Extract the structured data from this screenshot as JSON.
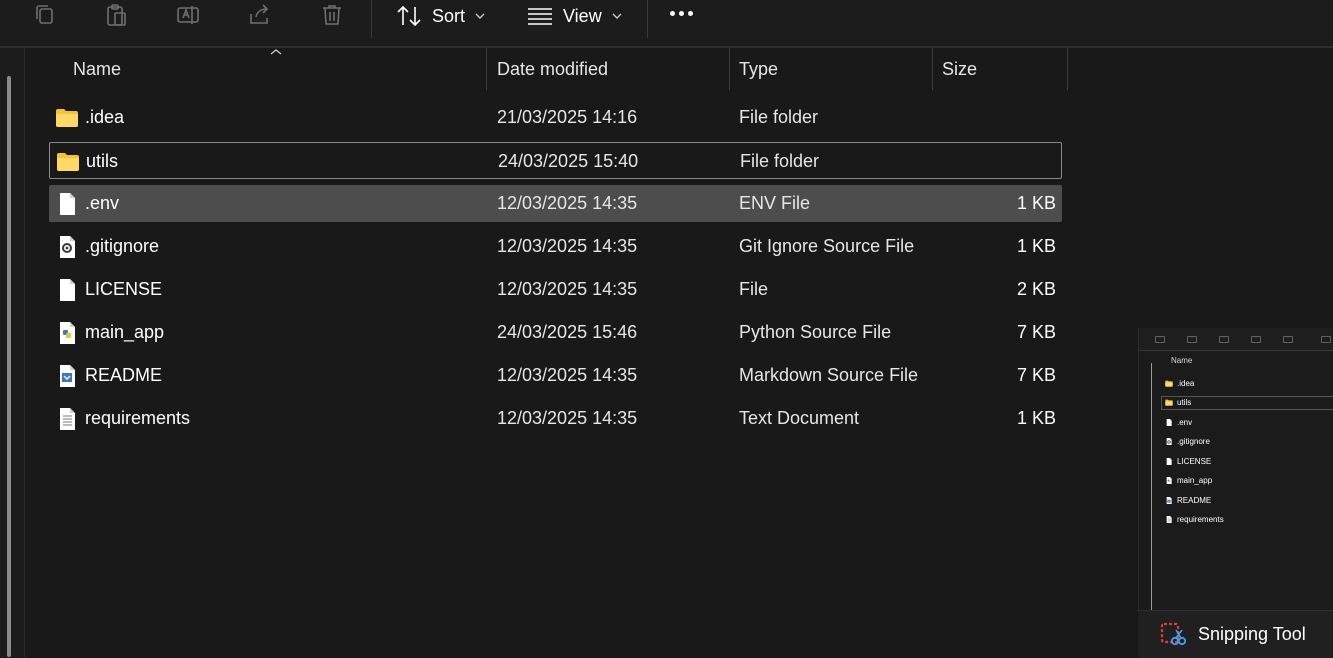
{
  "toolbar": {
    "actions": [
      {
        "icon": "copy-icon"
      },
      {
        "icon": "paste-icon"
      },
      {
        "icon": "rename-icon"
      },
      {
        "icon": "share-icon"
      },
      {
        "icon": "delete-icon"
      }
    ],
    "sort_label": "Sort",
    "view_label": "View"
  },
  "columns": {
    "name": "Name",
    "date_modified": "Date modified",
    "type": "Type",
    "size": "Size"
  },
  "files": [
    {
      "name": ".idea",
      "date": "21/03/2025 14:16",
      "type": "File folder",
      "size": "",
      "icon": "folder-icon"
    },
    {
      "name": "utils",
      "date": "24/03/2025 15:40",
      "type": "File folder",
      "size": "",
      "icon": "folder-icon"
    },
    {
      "name": ".env",
      "date": "12/03/2025 14:35",
      "type": "ENV File",
      "size": "1 KB",
      "icon": "file-icon"
    },
    {
      "name": ".gitignore",
      "date": "12/03/2025 14:35",
      "type": "Git Ignore Source File",
      "size": "1 KB",
      "icon": "gear-file-icon"
    },
    {
      "name": "LICENSE",
      "date": "12/03/2025 14:35",
      "type": "File",
      "size": "2 KB",
      "icon": "file-icon"
    },
    {
      "name": "main_app",
      "date": "24/03/2025 15:46",
      "type": "Python Source File",
      "size": "7 KB",
      "icon": "python-file-icon"
    },
    {
      "name": "README",
      "date": "12/03/2025 14:35",
      "type": "Markdown Source File",
      "size": "7 KB",
      "icon": "markdown-file-icon"
    },
    {
      "name": "requirements",
      "date": "12/03/2025 14:35",
      "type": "Text Document",
      "size": "1 KB",
      "icon": "text-file-icon"
    }
  ],
  "thumbnail": {
    "header": "Name",
    "rows": [
      ".idea",
      "utils",
      ".env",
      ".gitignore",
      "LICENSE",
      "main_app",
      "README",
      "requirements"
    ]
  },
  "notification": {
    "app_name": "Snipping Tool",
    "icon": "snipping-tool-icon"
  },
  "colors": {
    "background": "#191919",
    "selected_row": "#4d4d4d",
    "folder": "#f4c13f"
  }
}
